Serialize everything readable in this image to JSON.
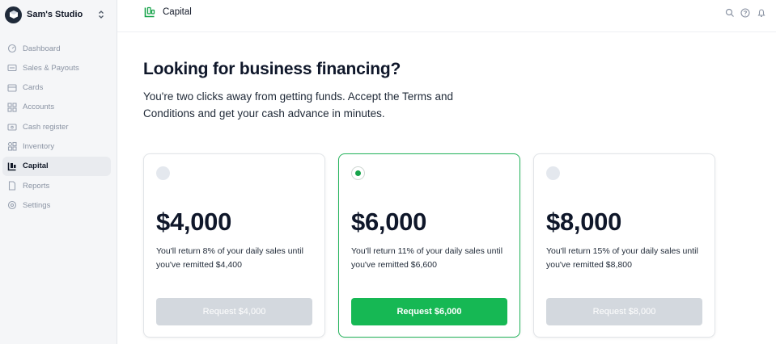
{
  "sidebar": {
    "workspace_name": "Sam's Studio",
    "items": [
      {
        "label": "Dashboard",
        "icon": "dashboard-icon"
      },
      {
        "label": "Sales & Payouts",
        "icon": "payouts-icon"
      },
      {
        "label": "Cards",
        "icon": "cards-icon"
      },
      {
        "label": "Accounts",
        "icon": "accounts-icon"
      },
      {
        "label": "Cash register",
        "icon": "cash-register-icon"
      },
      {
        "label": "Inventory",
        "icon": "inventory-icon"
      },
      {
        "label": "Capital",
        "icon": "capital-icon",
        "active": true
      },
      {
        "label": "Reports",
        "icon": "reports-icon"
      },
      {
        "label": "Settings",
        "icon": "settings-icon"
      }
    ]
  },
  "topbar": {
    "title": "Capital",
    "accent": "#16a34a"
  },
  "main": {
    "heading": "Looking for business financing?",
    "subtext": "You're two clicks away from getting funds. Accept the Terms and Conditions and get your cash advance in minutes.",
    "offers": [
      {
        "amount": "$4,000",
        "description": "You'll return 8% of your daily sales until you've remitted $4,400",
        "button": "Request $4,000",
        "selected": false
      },
      {
        "amount": "$6,000",
        "description": "You'll return 11% of your daily sales until you've remitted $6,600",
        "button": "Request $6,000",
        "selected": true
      },
      {
        "amount": "$8,000",
        "description": "You'll return 15% of your daily sales until you've remitted $8,800",
        "button": "Request $8,000",
        "selected": false
      }
    ]
  },
  "colors": {
    "primary_green": "#16b854",
    "disabled_button": "#d3d8de",
    "sidebar_bg": "#f5f6f8"
  }
}
